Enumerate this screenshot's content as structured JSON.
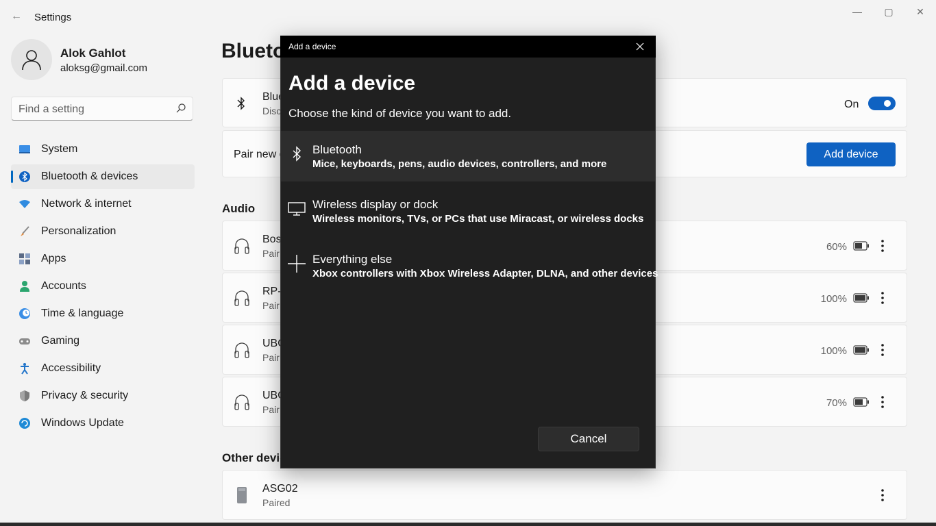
{
  "window": {
    "title": "Settings",
    "minimize": "—",
    "maximize": "▢",
    "close": "✕",
    "back": "←"
  },
  "profile": {
    "name": "Alok Gahlot",
    "email": "aloksg@gmail.com"
  },
  "search": {
    "placeholder": "Find a setting"
  },
  "nav": [
    {
      "label": "System",
      "icon": "system-icon",
      "color": "#3a8ee6"
    },
    {
      "label": "Bluetooth & devices",
      "icon": "bluetooth-icon",
      "color": "#0f62c2",
      "active": true
    },
    {
      "label": "Network & internet",
      "icon": "wifi-icon",
      "color": "#2f8be0"
    },
    {
      "label": "Personalization",
      "icon": "brush-icon",
      "color": "#e0883a"
    },
    {
      "label": "Apps",
      "icon": "apps-icon",
      "color": "#5a6a85"
    },
    {
      "label": "Accounts",
      "icon": "accounts-icon",
      "color": "#2ba56e"
    },
    {
      "label": "Time & language",
      "icon": "clock-globe-icon",
      "color": "#3a8ee6"
    },
    {
      "label": "Gaming",
      "icon": "gamepad-icon",
      "color": "#8c8c8c"
    },
    {
      "label": "Accessibility",
      "icon": "accessibility-icon",
      "color": "#1f73c9"
    },
    {
      "label": "Privacy & security",
      "icon": "shield-icon",
      "color": "#7b7b7b"
    },
    {
      "label": "Windows Update",
      "icon": "update-icon",
      "color": "#1f8ad6"
    }
  ],
  "main": {
    "title": "Blueto",
    "bluetooth_card": {
      "title": "Blue",
      "sub": "Disc",
      "toggle_label": "On"
    },
    "pair_card": {
      "title": "Pair new d",
      "button": "Add device"
    },
    "audio_section": "Audio",
    "audio_devices": [
      {
        "title": "Bos",
        "sub": "Pair",
        "battery": "60%"
      },
      {
        "title": "RP-",
        "sub": "Pair",
        "battery": "100%"
      },
      {
        "title": "UBO",
        "sub": "Pair",
        "battery": "100%"
      },
      {
        "title": "UBO",
        "sub": "Pair",
        "battery": "70%"
      }
    ],
    "other_section": "Other devic",
    "other_devices": [
      {
        "title": "ASG02",
        "sub": "Paired"
      }
    ]
  },
  "dialog": {
    "titlebar": "Add a device",
    "heading": "Add a device",
    "subtitle": "Choose the kind of device you want to add.",
    "options": [
      {
        "title": "Bluetooth",
        "desc": "Mice, keyboards, pens, audio devices, controllers, and more",
        "icon": "bluetooth-icon"
      },
      {
        "title": "Wireless display or dock",
        "desc": "Wireless monitors, TVs, or PCs that use Miracast, or wireless docks",
        "icon": "monitor-icon"
      },
      {
        "title": "Everything else",
        "desc": "Xbox controllers with Xbox Wireless Adapter, DLNA, and other devices",
        "icon": "plus-icon"
      }
    ],
    "cancel": "Cancel"
  }
}
